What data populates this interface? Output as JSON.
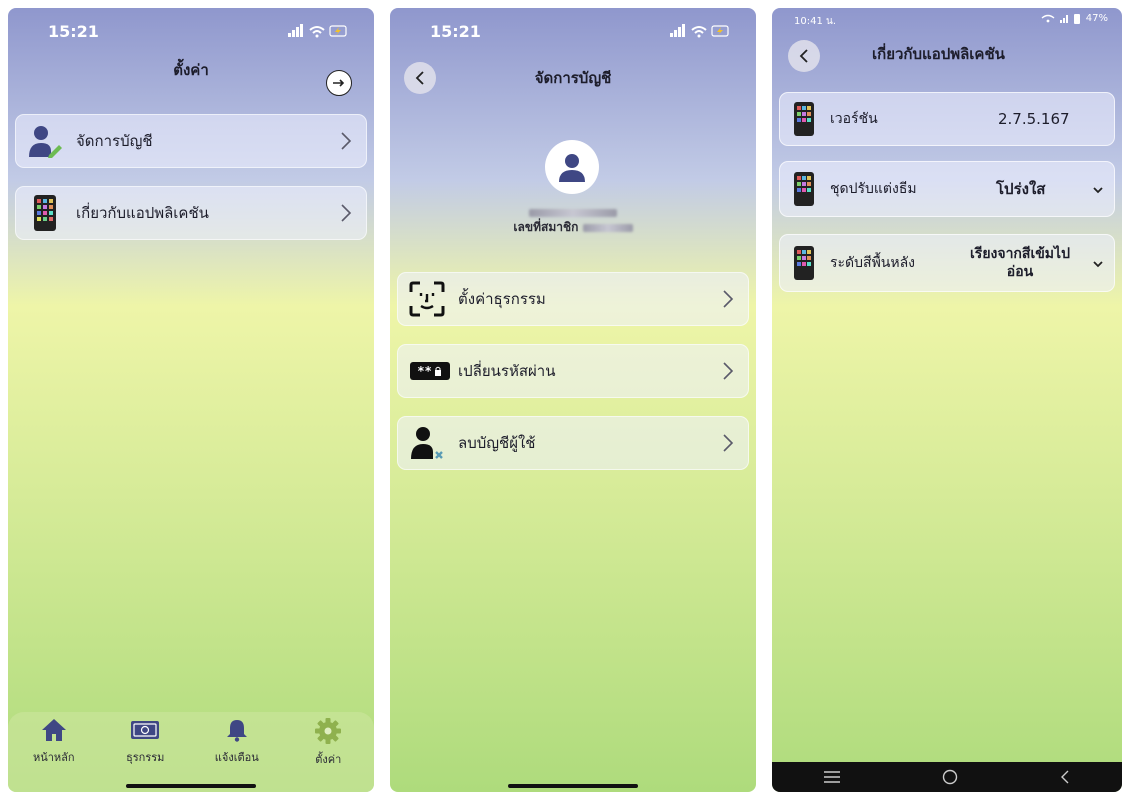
{
  "screen1": {
    "time": "15:21",
    "title": "ตั้งค่า",
    "items": [
      {
        "label": "จัดการบัญชี"
      },
      {
        "label": "เกี่ยวกับแอปพลิเคชัน"
      }
    ],
    "tabs": [
      {
        "label": "หน้าหลัก"
      },
      {
        "label": "ธุรกรรม"
      },
      {
        "label": "แจ้งเตือน"
      },
      {
        "label": "ตั้งค่า"
      }
    ]
  },
  "screen2": {
    "time": "15:21",
    "title": "จัดการบัญชี",
    "member_label": "เลขที่สมาชิก",
    "items": [
      {
        "label": "ตั้งค่าธุรกรรม"
      },
      {
        "label": "เปลี่ยนรหัสผ่าน"
      },
      {
        "label": "ลบบัญชีผู้ใช้"
      }
    ],
    "password_icon_text": "**"
  },
  "screen3": {
    "time": "10:41 น.",
    "battery": "47%",
    "title": "เกี่ยวกับแอปพลิเคชัน",
    "version_label": "เวอร์ชัน",
    "version_value": "2.7.5.167",
    "theme_label": "ชุดปรับแต่งธีม",
    "theme_value": "โปร่งใส",
    "bg_label": "ระดับสีพื้นหลัง",
    "bg_value": "เรียงจากสีเข้มไปอ่อน"
  },
  "colors": {
    "icon_blue": "#3f4784",
    "tab_green": "#8fb14e",
    "pencil_green": "#6dbb52"
  }
}
